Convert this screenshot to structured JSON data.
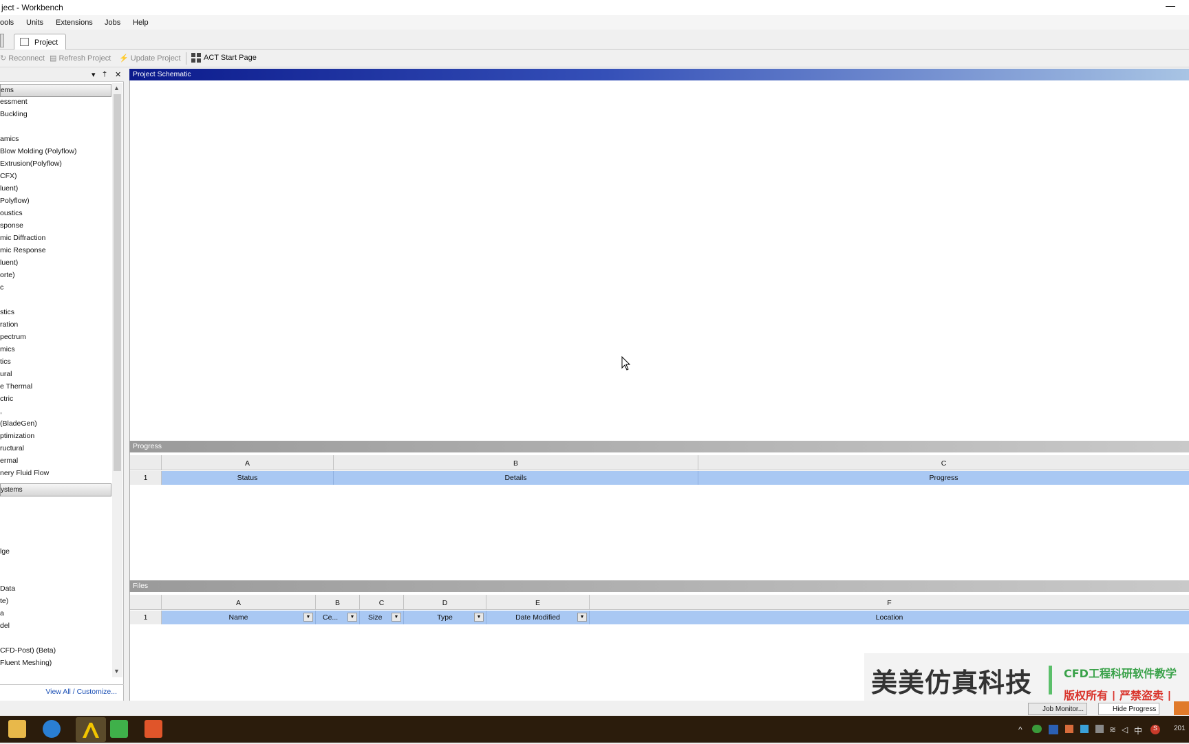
{
  "window": {
    "title": "ject - Workbench",
    "minimize_glyph": "—"
  },
  "menu": [
    "ools",
    "Units",
    "Extensions",
    "Jobs",
    "Help"
  ],
  "tabs": {
    "project": "Project"
  },
  "toolbar": {
    "reconnect": "Reconnect",
    "refresh": "Refresh Project",
    "update": "Update Project",
    "act": "ACT Start Page"
  },
  "toolbox": {
    "header_glyphs": {
      "dropdown": "▾",
      "pin": "†",
      "close": "✕"
    },
    "category_analysis": "ems",
    "analysis_items": [
      "essment",
      "Buckling",
      "",
      "amics",
      "Blow Molding (Polyflow)",
      "Extrusion(Polyflow)",
      "CFX)",
      "luent)",
      "Polyflow)",
      "oustics",
      "sponse",
      "mic Diffraction",
      "mic Response",
      "luent)",
      "orte)",
      "c",
      "",
      "stics",
      "ration",
      "pectrum",
      "mics",
      "tics",
      "ural",
      "e Thermal",
      "ctric",
      ",",
      "(BladeGen)",
      "ptimization",
      "ructural",
      "ermal",
      "nery Fluid Flow"
    ],
    "category_component": "ystems",
    "component_items": [
      "",
      "",
      "",
      "",
      "lge",
      "",
      "",
      "Data",
      "te)",
      "a",
      "del",
      "",
      "CFD-Post) (Beta)",
      "Fluent Meshing)"
    ],
    "view_all": "View All / Customize..."
  },
  "schematic": {
    "title": "Project Schematic"
  },
  "progress": {
    "title": "Progress",
    "columns": [
      "A",
      "B",
      "C"
    ],
    "row_number": "1",
    "headers": [
      "Status",
      "Details",
      "Progress"
    ]
  },
  "files": {
    "title": "Files",
    "columns": [
      "A",
      "B",
      "C",
      "D",
      "E",
      "F"
    ],
    "row_number": "1",
    "headers": [
      "Name",
      "Ce...",
      "Size",
      "Type",
      "Date Modified",
      "Location"
    ],
    "dropdown_glyph": "▼"
  },
  "watermark": {
    "brand": "美美仿真科技",
    "line1": "CFD工程科研软件教学",
    "line2": "版权所有 | 严禁盗卖 |"
  },
  "statusbar": {
    "job_monitor": "Job Monitor...",
    "hide_progress": "Hide Progress"
  },
  "taskbar": {
    "tray": [
      "^",
      "中",
      "S"
    ],
    "clock": "201"
  },
  "colors": {
    "schematic_header_start": "#0b1a8c",
    "row_highlight": "#a9c8f3",
    "watermark_green": "#3aa24a",
    "watermark_red": "#d9332b"
  }
}
